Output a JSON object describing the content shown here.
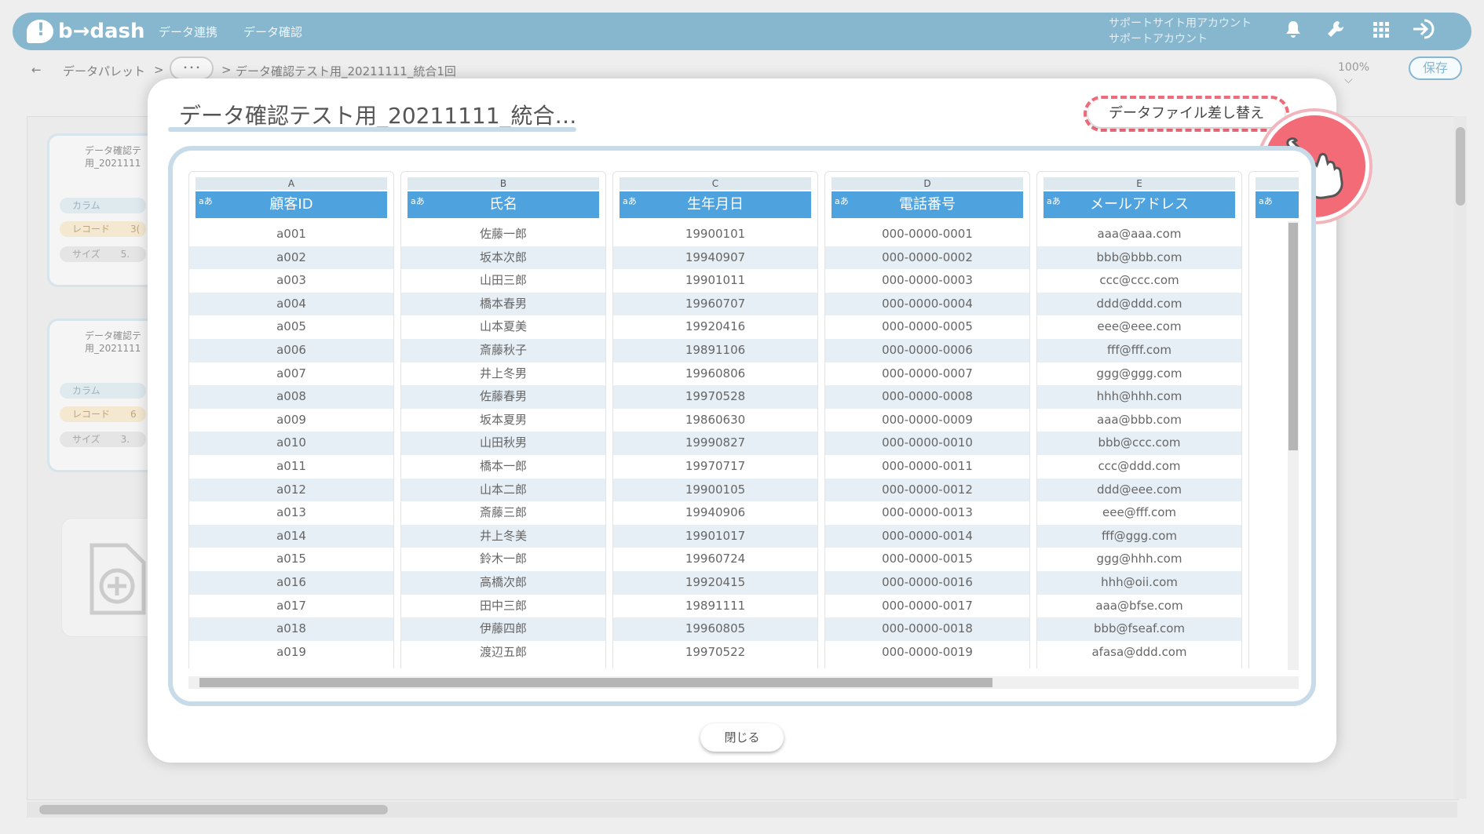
{
  "app": {
    "logo_text": "b→dash",
    "nav": [
      "データ連携",
      "データ確認"
    ],
    "account": {
      "line1": "サポートサイト用アカウント",
      "line2": "サポートアカウント"
    },
    "icons": [
      "bell-icon",
      "wrench-icon",
      "grid-icon",
      "logout-icon"
    ]
  },
  "breadcrumb": {
    "back": "←",
    "root": "データパレット",
    "sep1": ">",
    "more": "･･･",
    "sep2": ">",
    "current": "データ確認テスト用_20211111_統合1回"
  },
  "toolbar": {
    "zoom": "100%",
    "zoom_caret": "⌵",
    "save_label": "保存"
  },
  "background_cards": [
    {
      "title1": "データ確認テ",
      "title2": "用_2021111",
      "col_label": "カラム",
      "rec_label": "レコード",
      "rec_value": "3(",
      "size_label": "サイズ",
      "size_value": "5."
    },
    {
      "title1": "データ確認テ",
      "title2": "用_2021111",
      "col_label": "カラム",
      "rec_label": "レコード",
      "rec_value": "6",
      "size_label": "サイズ",
      "size_value": "3."
    }
  ],
  "modal": {
    "title": "データ確認テスト用_20211111_統合…",
    "replace_label": "データファイル差し替え",
    "close_label": "閉じる",
    "type_mark": "aあ",
    "columns": [
      {
        "letter": "A",
        "header": "顧客ID",
        "values": [
          "a001",
          "a002",
          "a003",
          "a004",
          "a005",
          "a006",
          "a007",
          "a008",
          "a009",
          "a010",
          "a011",
          "a012",
          "a013",
          "a014",
          "a015",
          "a016",
          "a017",
          "a018",
          "a019"
        ]
      },
      {
        "letter": "B",
        "header": "氏名",
        "values": [
          "佐藤一郎",
          "坂本次郎",
          "山田三郎",
          "橋本春男",
          "山本夏美",
          "斎藤秋子",
          "井上冬男",
          "佐藤春男",
          "坂本夏男",
          "山田秋男",
          "橋本一郎",
          "山本二郎",
          "斎藤三郎",
          "井上冬美",
          "鈴木一郎",
          "高橋次郎",
          "田中三郎",
          "伊藤四郎",
          "渡辺五郎"
        ]
      },
      {
        "letter": "C",
        "header": "生年月日",
        "values": [
          "19900101",
          "19940907",
          "19901011",
          "19960707",
          "19920416",
          "19891106",
          "19960806",
          "19970528",
          "19860630",
          "19990827",
          "19970717",
          "19900105",
          "19940906",
          "19901017",
          "19960724",
          "19920415",
          "19891111",
          "19960805",
          "19970522"
        ]
      },
      {
        "letter": "D",
        "header": "電話番号",
        "values": [
          "000-0000-0001",
          "000-0000-0002",
          "000-0000-0003",
          "000-0000-0004",
          "000-0000-0005",
          "000-0000-0006",
          "000-0000-0007",
          "000-0000-0008",
          "000-0000-0009",
          "000-0000-0010",
          "000-0000-0011",
          "000-0000-0012",
          "000-0000-0013",
          "000-0000-0014",
          "000-0000-0015",
          "000-0000-0016",
          "000-0000-0017",
          "000-0000-0018",
          "000-0000-0019"
        ]
      },
      {
        "letter": "E",
        "header": "メールアドレス",
        "values": [
          "aaa@aaa.com",
          "bbb@bbb.com",
          "ccc@ccc.com",
          "ddd@ddd.com",
          "eee@eee.com",
          "fff@fff.com",
          "ggg@ggg.com",
          "hhh@hhh.com",
          "aaa@bbb.com",
          "bbb@ccc.com",
          "ccc@ddd.com",
          "ddd@eee.com",
          "eee@fff.com",
          "fff@ggg.com",
          "ggg@hhh.com",
          "hhh@oii.com",
          "aaa@bfse.com",
          "bbb@fseaf.com",
          "afasa@ddd.com"
        ]
      }
    ]
  }
}
